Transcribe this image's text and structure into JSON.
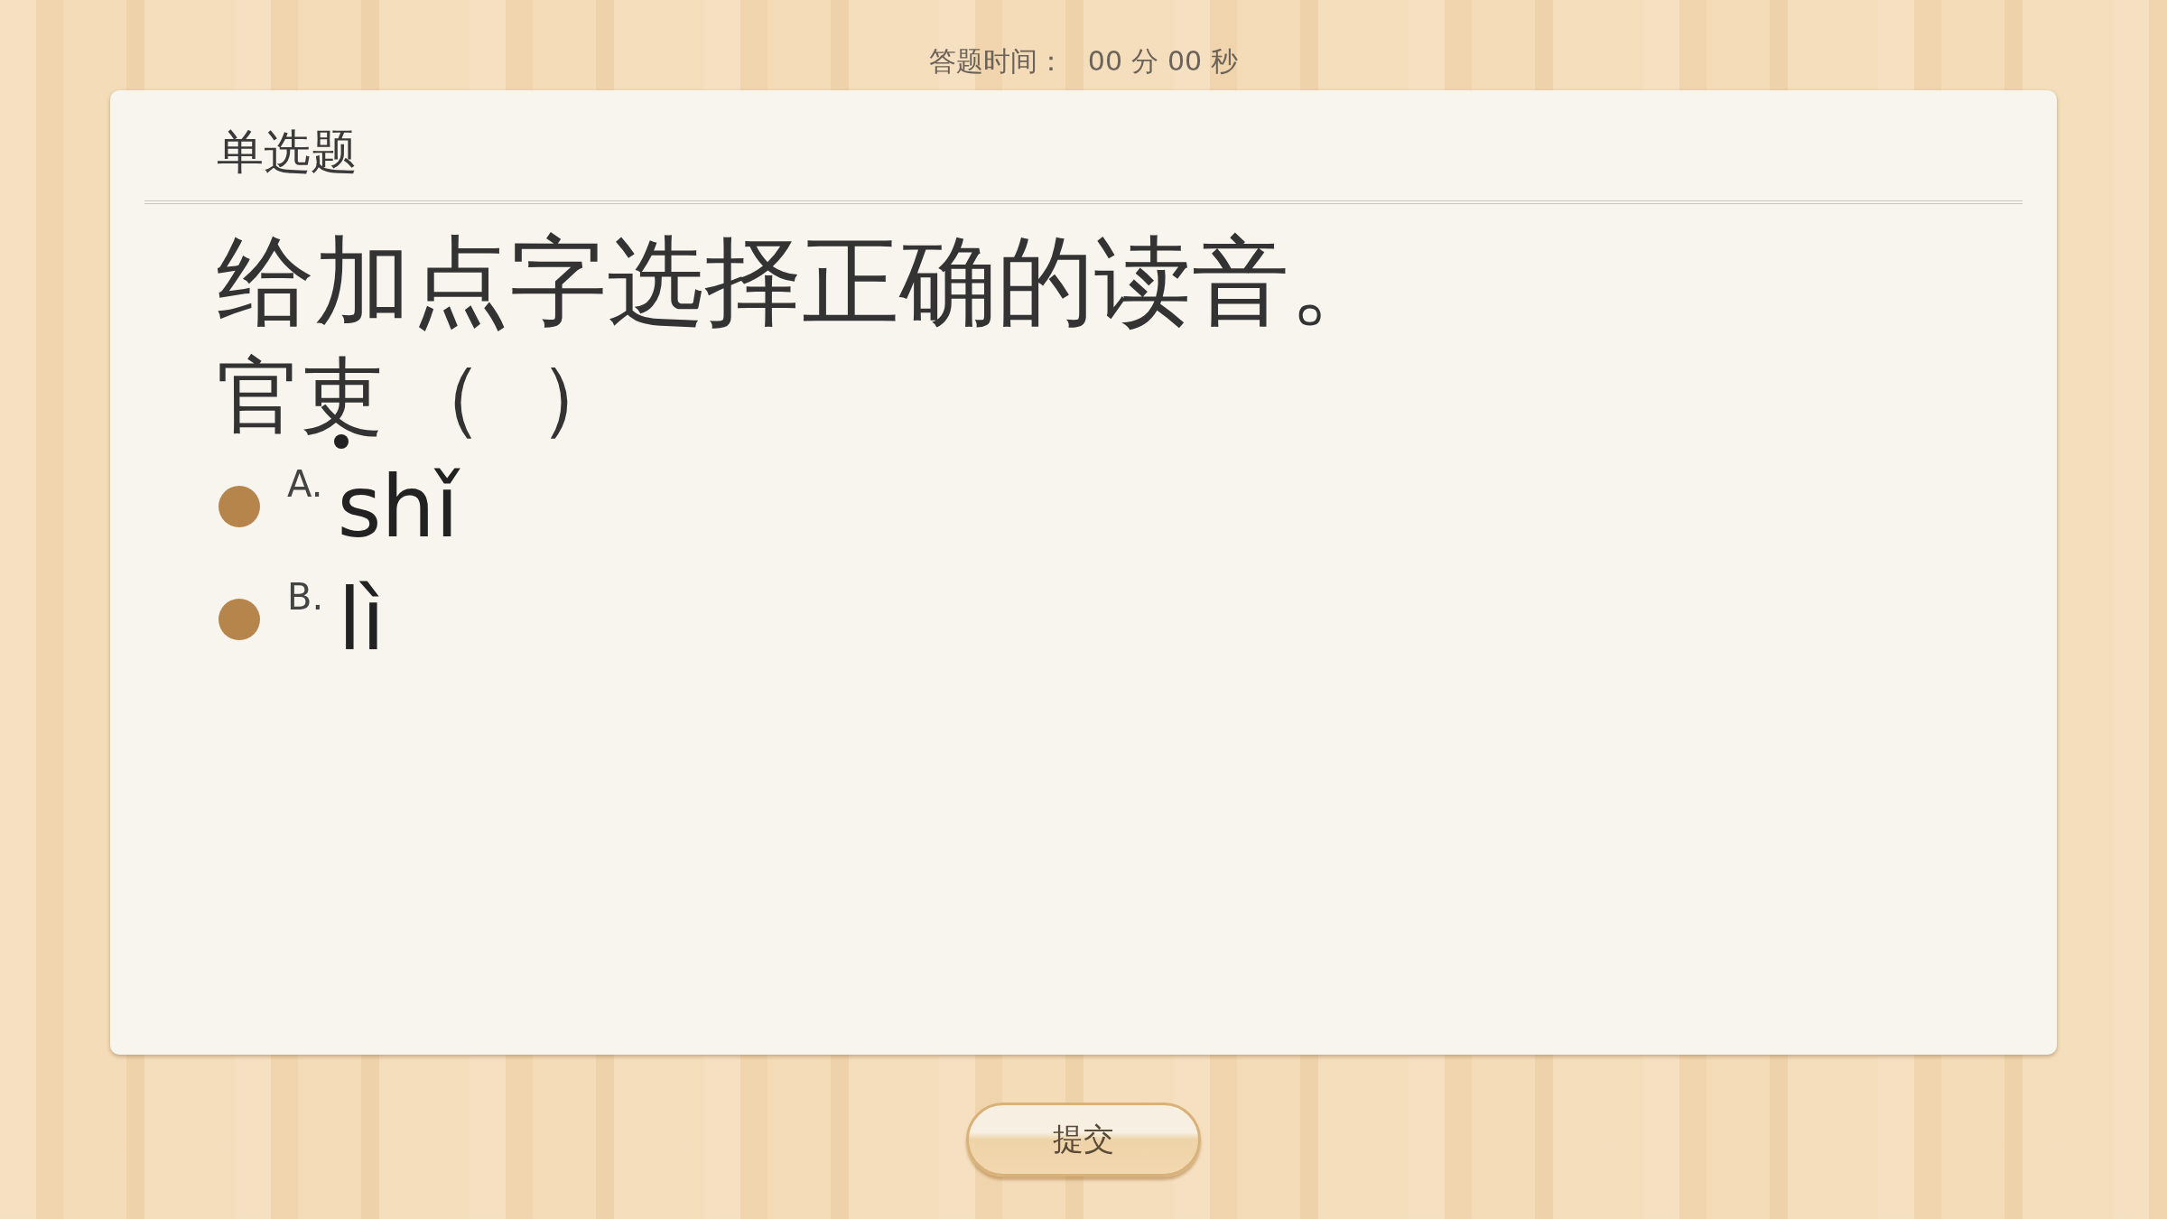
{
  "timer": {
    "label": "答题时间：",
    "minutes": "00",
    "minutes_unit": "分",
    "seconds": "00",
    "seconds_unit": "秒"
  },
  "card": {
    "type_label": "单选题",
    "prompt": "给加点字选择正确的读音。",
    "word_parts": [
      {
        "text": "官",
        "dotted": false
      },
      {
        "text": "吏",
        "dotted": true
      },
      {
        "text": "（",
        "dotted": false
      },
      {
        "text": "）",
        "dotted": false
      }
    ],
    "options": [
      {
        "letter": "A.",
        "text": "shǐ",
        "selected": false
      },
      {
        "letter": "B.",
        "text": "lì",
        "selected": false
      }
    ]
  },
  "submit_button": "提交"
}
